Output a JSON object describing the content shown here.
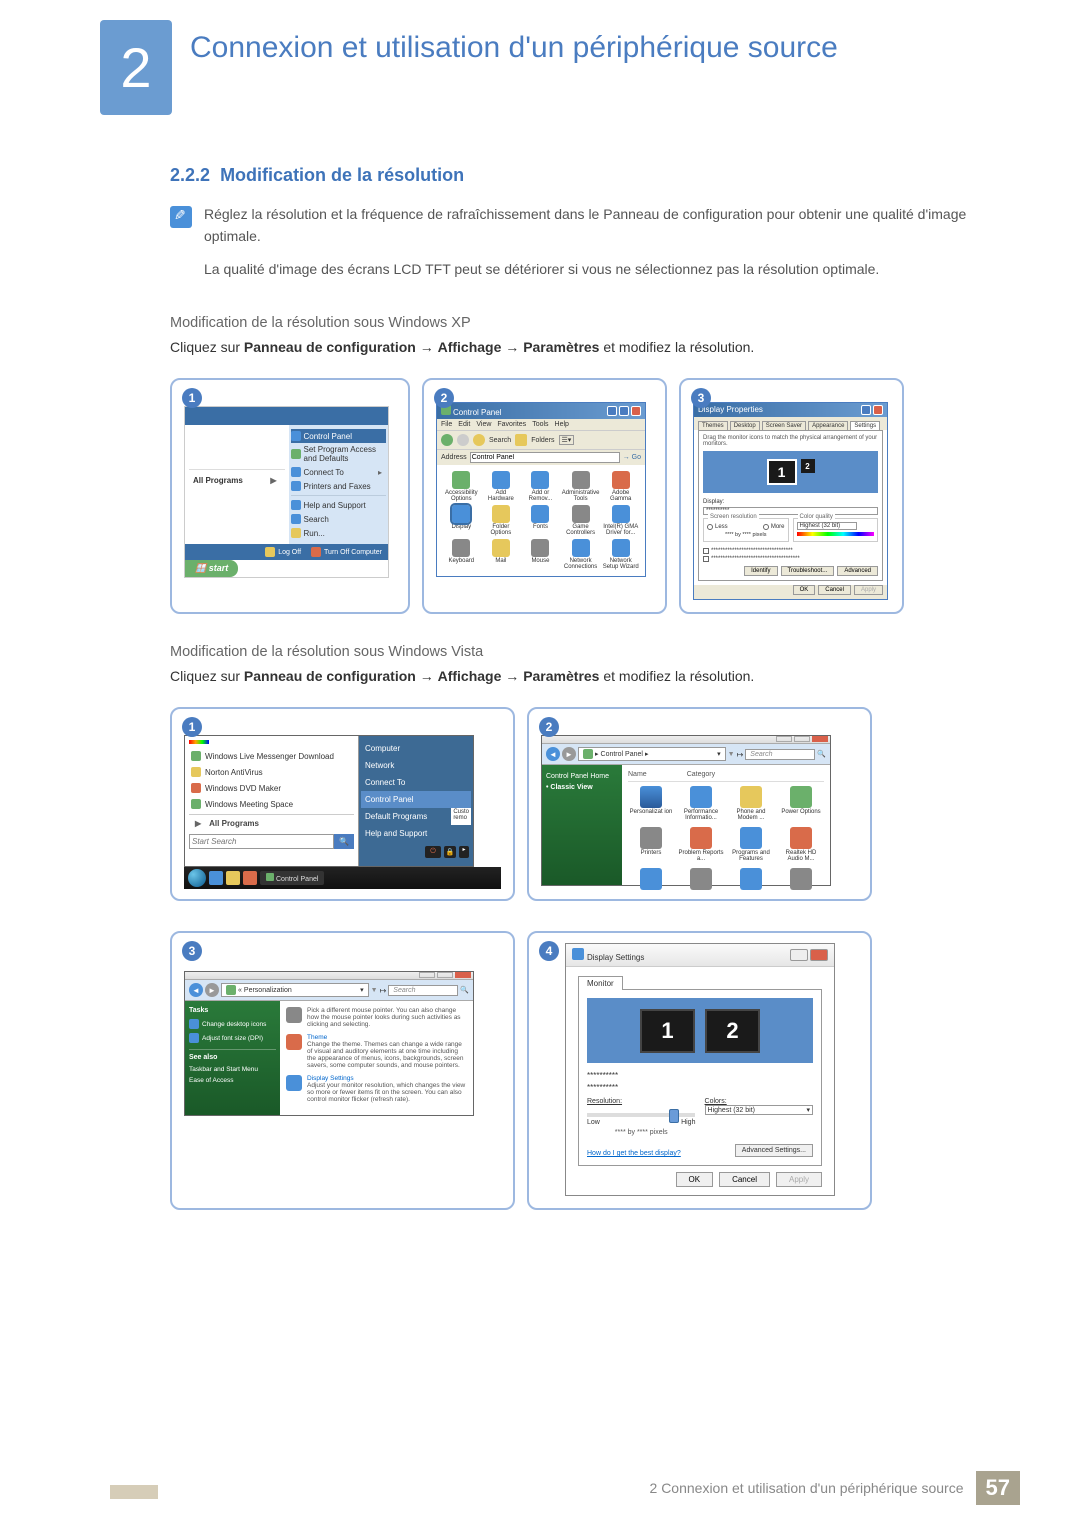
{
  "chapter": {
    "number": "2",
    "title": "Connexion et utilisation d'un périphérique source"
  },
  "section": {
    "number": "2.2.2",
    "title": "Modification de la résolution"
  },
  "note": {
    "p1": "Réglez la résolution et la fréquence de rafraîchissement dans le Panneau de configuration pour obtenir une qualité d'image optimale.",
    "p2": "La qualité d'image des écrans LCD TFT peut se détériorer si vous ne sélectionnez pas la résolution optimale."
  },
  "xp": {
    "heading": "Modification de la résolution sous Windows XP",
    "instruction_pre": "Cliquez sur ",
    "instruction_b1": "Panneau de configuration",
    "instruction_b2": "Affichage",
    "instruction_b3": "Paramètres",
    "instruction_post": " et modifiez la résolution.",
    "arrow": " → ",
    "shots": {
      "b1": "1",
      "b2": "2",
      "b3": "3"
    },
    "start": {
      "right_panel_hl": "Control Panel",
      "right_items": [
        "Set Program Access and Defaults",
        "Connect To",
        "Printers and Faxes",
        "Help and Support",
        "Search",
        "Run..."
      ],
      "all_programs": "All Programs",
      "logoff": "Log Off",
      "turnoff": "Turn Off Computer",
      "start_btn": "start"
    },
    "cp": {
      "title": "Control Panel",
      "menu": [
        "File",
        "Edit",
        "View",
        "Favorites",
        "Tools",
        "Help"
      ],
      "toolbar_search": "Search",
      "toolbar_folders": "Folders",
      "addr_label": "Address",
      "addr_value": "Control Panel",
      "go": "Go",
      "items": [
        "Accessibility Options",
        "Add Hardware",
        "Add or Remov...",
        "Administrative Tools",
        "Adobe Gamma",
        "Display",
        "Folder Options",
        "Fonts",
        "Game Controllers",
        "Intel(R) GMA Driver for...",
        "Keyboard",
        "Mail",
        "Mouse",
        "Network Connections",
        "Network Setup Wizard"
      ],
      "selected": "Display"
    },
    "dp": {
      "title": "Display Properties",
      "tabs": [
        "Themes",
        "Desktop",
        "Screen Saver",
        "Appearance",
        "Settings"
      ],
      "desc": "Drag the monitor icons to match the physical arrangement of your monitors.",
      "mon1": "1",
      "mon2": "2",
      "display_label": "Display:",
      "display_val": "**********",
      "res_group": "Screen resolution",
      "qual_group": "Color quality",
      "radio_less": "Less",
      "radio_more": "More",
      "qual_val": "Highest (32 bit)",
      "res_val": "**** by **** pixels",
      "chk1": "***********************************",
      "chk2": "**************************************",
      "btns_mid": [
        "Identify",
        "Troubleshoot...",
        "Advanced"
      ],
      "btns_bot": [
        "OK",
        "Cancel",
        "Apply"
      ]
    }
  },
  "vista": {
    "heading": "Modification de la résolution sous Windows Vista",
    "instruction_pre": "Cliquez sur ",
    "instruction_b1": "Panneau de configuration",
    "instruction_b2": "Affichage",
    "instruction_b3": "Paramètres",
    "instruction_post": " et modifiez la résolution.",
    "arrow": " → ",
    "shots": {
      "b1": "1",
      "b2": "2",
      "b3": "3",
      "b4": "4"
    },
    "start": {
      "left_items": [
        "Windows Live Messenger Download",
        "Norton AntiVirus",
        "Windows DVD Maker",
        "Windows Meeting Space"
      ],
      "all_programs": "All Programs",
      "search_placeholder": "Start Search",
      "right_items": [
        "Computer",
        "Network",
        "Connect To",
        "Control Panel",
        "Default Programs",
        "Help and Support"
      ],
      "right_hl": "Control Panel",
      "sub_right": [
        "Custo",
        "remo"
      ],
      "taskbar_btn": "Control Panel"
    },
    "cp": {
      "path": "Control Panel",
      "search_placeholder": "Search",
      "side_title": "Control Panel Home",
      "side_item": "Classic View",
      "col_name": "Name",
      "col_cat": "Category",
      "items": [
        "Personalizat ion",
        "Performance Informatio...",
        "Phone and Modem ...",
        "Power Options",
        "Printers",
        "Problem Reports a...",
        "Programs and Features",
        "Realtek HD Audio M..."
      ]
    },
    "pers": {
      "path": "Personalization",
      "search_placeholder": "Search",
      "side_h": "Tasks",
      "side_items": [
        "Change desktop icons",
        "Adjust font size (DPI)"
      ],
      "side_h2": "See also",
      "side_items2": [
        "Taskbar and Start Menu",
        "Ease of Access"
      ],
      "task1_desc": "Pick a different mouse pointer. You can also change how the mouse pointer looks during such activities as clicking and selecting.",
      "task2_label": "Theme",
      "task2_desc": "Change the theme. Themes can change a wide range of visual and auditory elements at one time including the appearance of menus, icons, backgrounds, screen savers, some computer sounds, and mouse pointers.",
      "task3_label": "Display Settings",
      "task3_desc": "Adjust your monitor resolution, which changes the view so more or fewer items fit on the screen. You can also control monitor flicker (refresh rate)."
    },
    "ds": {
      "title": "Display Settings",
      "tab": "Monitor",
      "mon1": "1",
      "mon2": "2",
      "id1": "**********",
      "id2": "**********",
      "res_label": "Resolution:",
      "col_label": "Colors:",
      "slider_low": "Low",
      "slider_high": "High",
      "col_val": "Highest (32 bit)",
      "pixel_note": "**** by **** pixels",
      "help_link": "How do I get the best display?",
      "adv_btn": "Advanced Settings...",
      "btns": [
        "OK",
        "Cancel",
        "Apply"
      ]
    }
  },
  "footer": {
    "text": "2 Connexion et utilisation d'un périphérique source",
    "page": "57"
  }
}
